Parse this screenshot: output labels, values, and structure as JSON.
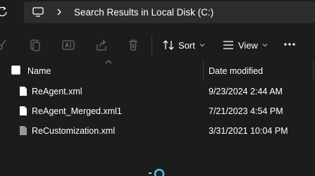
{
  "address": {
    "breadcrumb": "Search Results in Local Disk (C:)"
  },
  "toolbar": {
    "sort_label": "Sort",
    "view_label": "View"
  },
  "columns": {
    "name": "Name",
    "date_modified": "Date modified"
  },
  "files": [
    {
      "name": "ReAgent.xml",
      "date": "9/23/2024 2:44 AM",
      "icon": "document-icon"
    },
    {
      "name": "ReAgent_Merged.xml1",
      "date": "7/21/2023 4:54 PM",
      "icon": "document-icon"
    },
    {
      "name": "ReCustomization.xml",
      "date": "3/31/2021 10:04 PM",
      "icon": "document-icon"
    }
  ],
  "colors": {
    "background": "#1c1c1c",
    "address_bar": "#2d2d2d",
    "accent": "#4cc2ff"
  }
}
